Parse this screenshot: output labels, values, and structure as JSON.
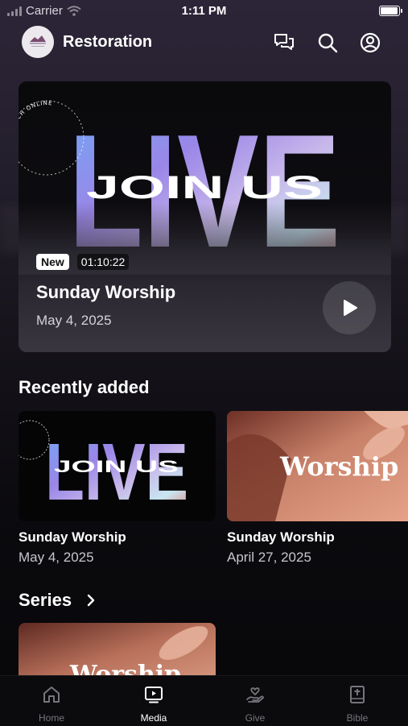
{
  "status_bar": {
    "carrier": "Carrier",
    "time": "1:11 PM",
    "battery_level": 0.95
  },
  "header": {
    "title": "Restoration",
    "icons": [
      "chat-icon",
      "search-icon",
      "profile-icon"
    ]
  },
  "featured": {
    "art_words": {
      "big": "LIVE",
      "overlay": "JOIN US",
      "ring": "CHURCH ONLINE"
    },
    "badge_new": "New",
    "duration": "01:10:22",
    "title": "Sunday Worship",
    "date": "May 4, 2025"
  },
  "recently_added": {
    "heading": "Recently added",
    "items": [
      {
        "title": "Sunday Worship",
        "date": "May 4, 2025",
        "art_big": "LIVE",
        "art_overlay": "JOIN US"
      },
      {
        "title": "Sunday Worship",
        "date": "April 27, 2025",
        "art_text": "Worship"
      }
    ]
  },
  "series": {
    "heading": "Series",
    "art_text": "Worship"
  },
  "tabs": [
    {
      "label": "Home",
      "icon": "home-icon",
      "active": false
    },
    {
      "label": "Media",
      "icon": "tv-icon",
      "active": true
    },
    {
      "label": "Give",
      "icon": "give-icon",
      "active": false
    },
    {
      "label": "Bible",
      "icon": "bible-icon",
      "active": false
    }
  ],
  "colors": {
    "background": "#0b0a0e",
    "accent": "#ffffff",
    "tab_inactive": "#77747c"
  }
}
